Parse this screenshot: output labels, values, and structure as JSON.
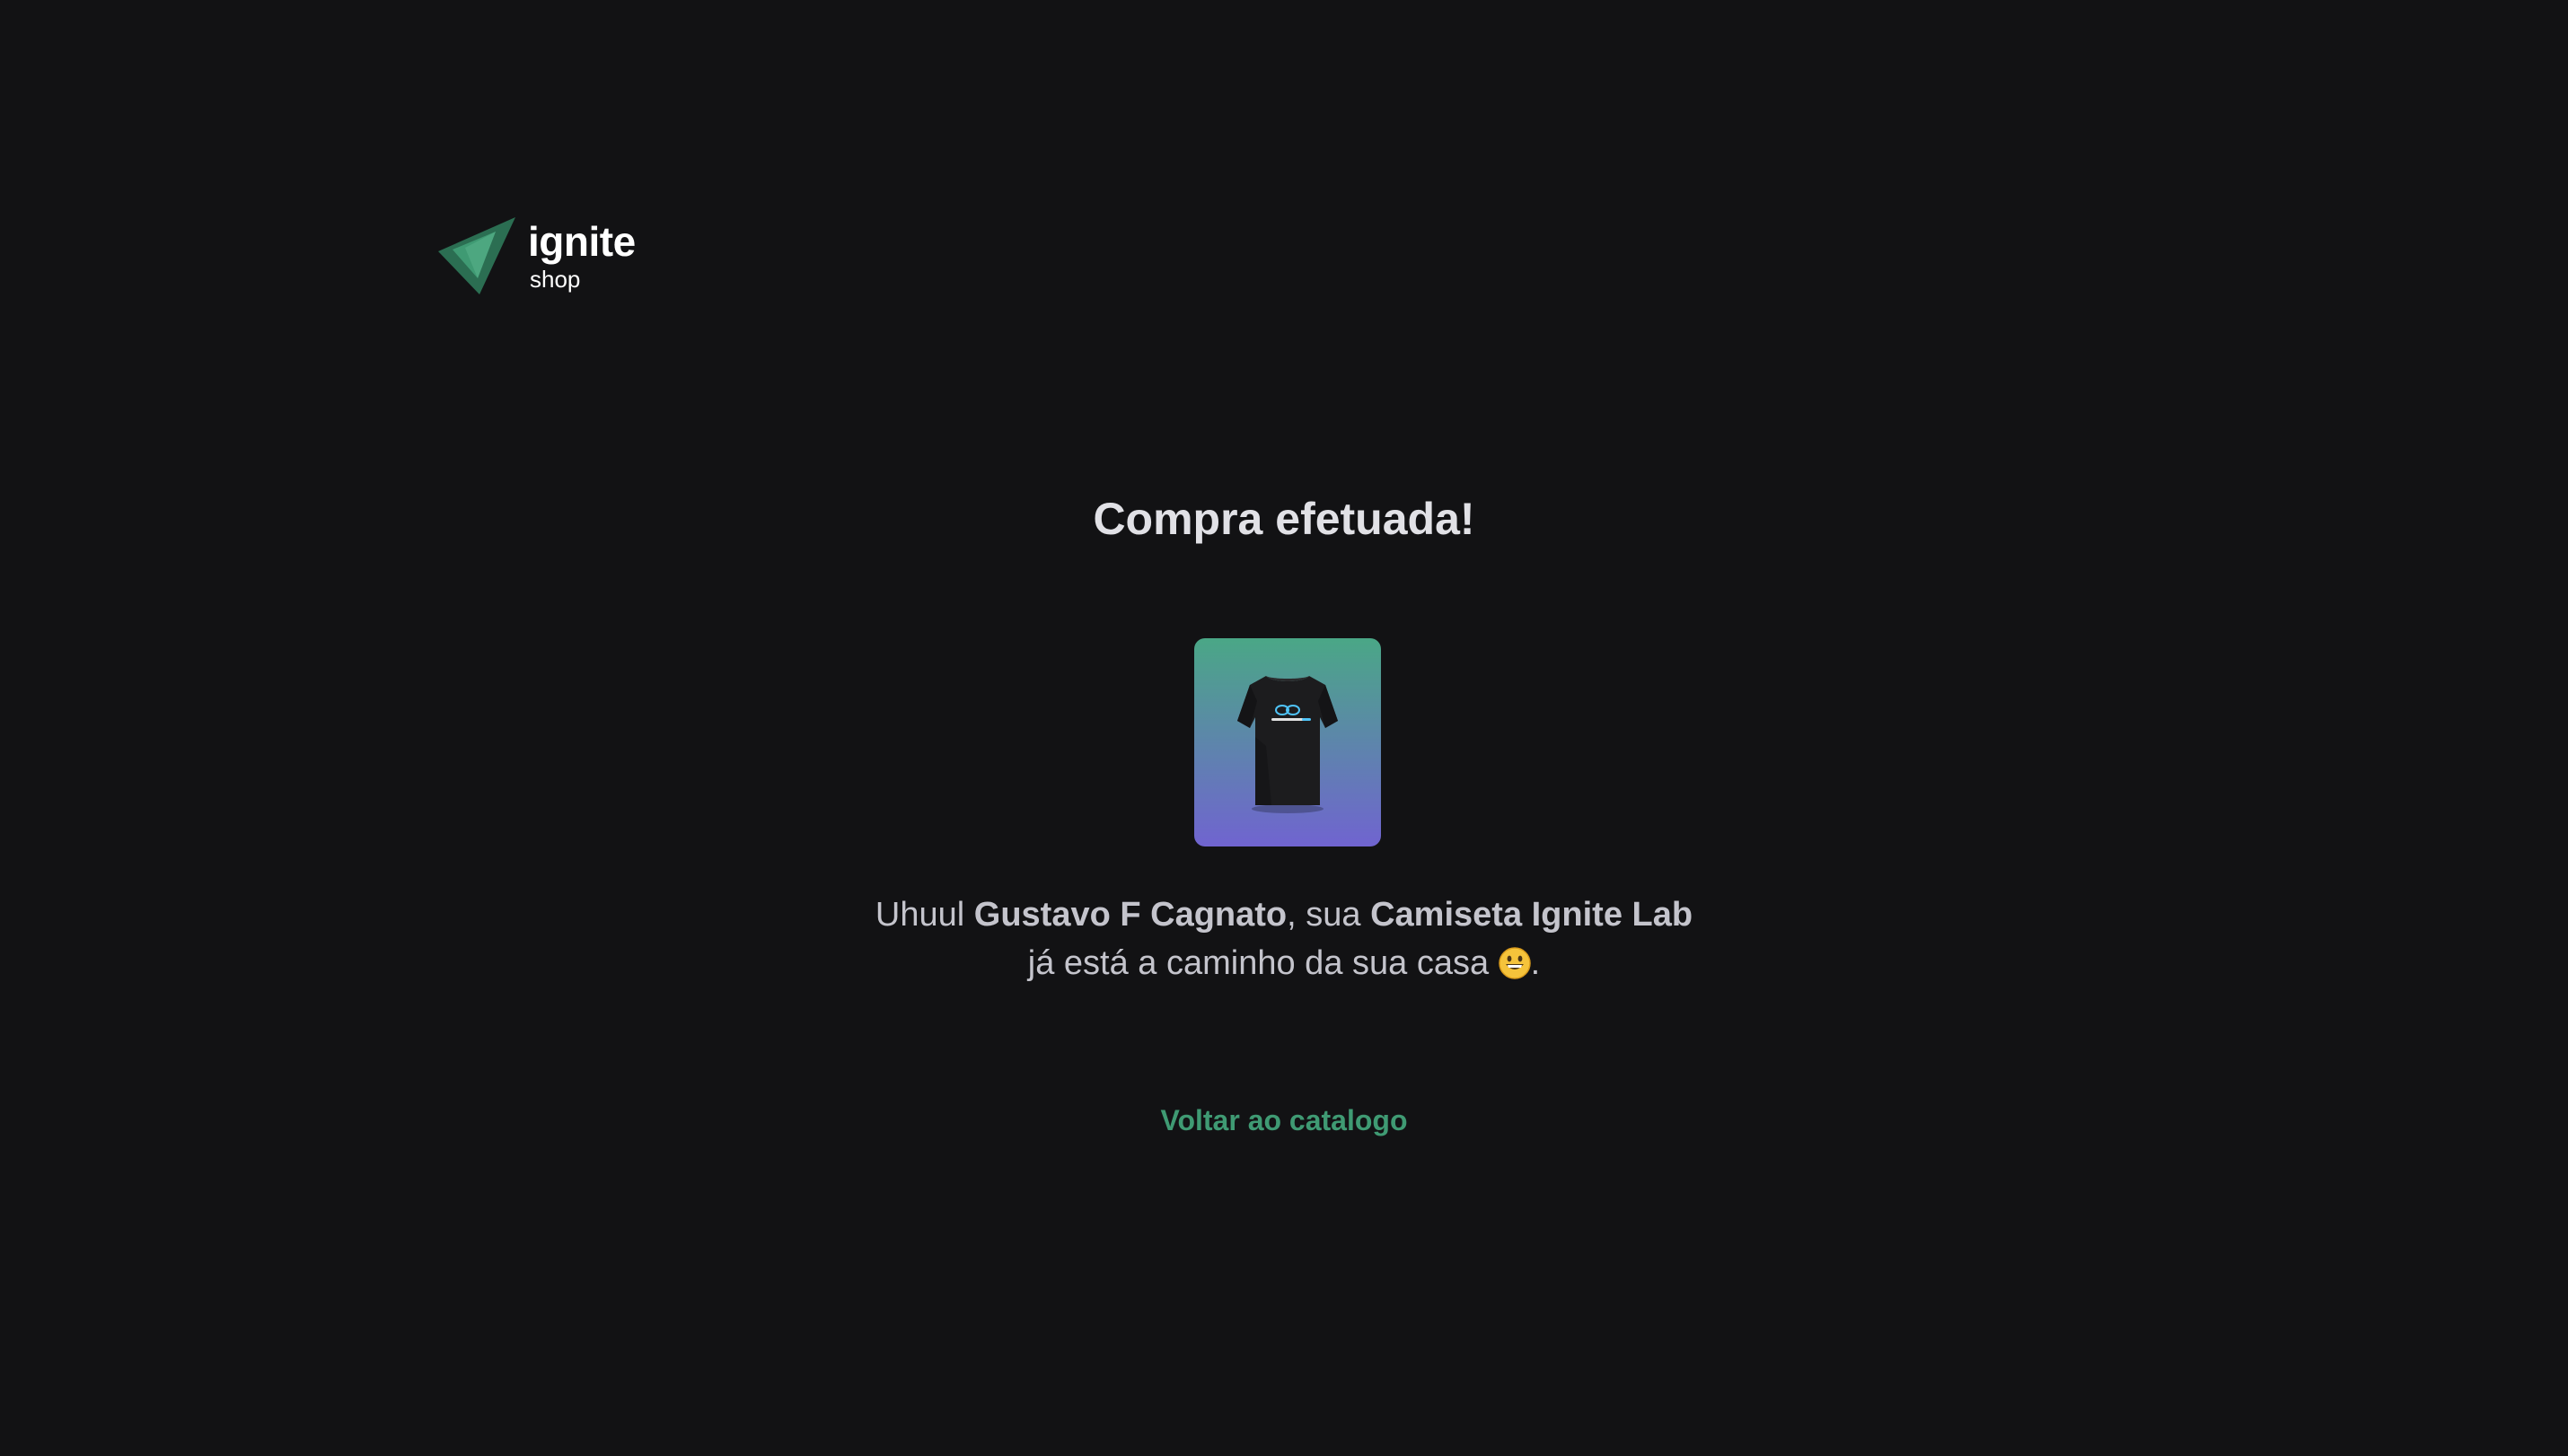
{
  "header": {
    "logo": {
      "name": "ignite",
      "sub": "shop",
      "icon": "triangle-logo-icon"
    }
  },
  "main": {
    "title": "Compra efetuada!",
    "product_image": {
      "icon": "t-shirt-image"
    },
    "message": {
      "prefix": "Uhuul ",
      "customer_name": "Gustavo F Cagnato",
      "middle": ", sua ",
      "product_name": "Camiseta Ignite Lab",
      "line2": "já está a caminho da sua casa ",
      "emoji": "grinning-face-emoji",
      "suffix": "."
    },
    "back_link": "Voltar ao catalogo"
  },
  "colors": {
    "background": "#121214",
    "title": "#e1e1e6",
    "text": "#c4c4cc",
    "link": "#3f9a73",
    "logo_green": "#2e7b5a",
    "image_gradient_top": "#4aa786",
    "image_gradient_bottom": "#7064d0"
  }
}
